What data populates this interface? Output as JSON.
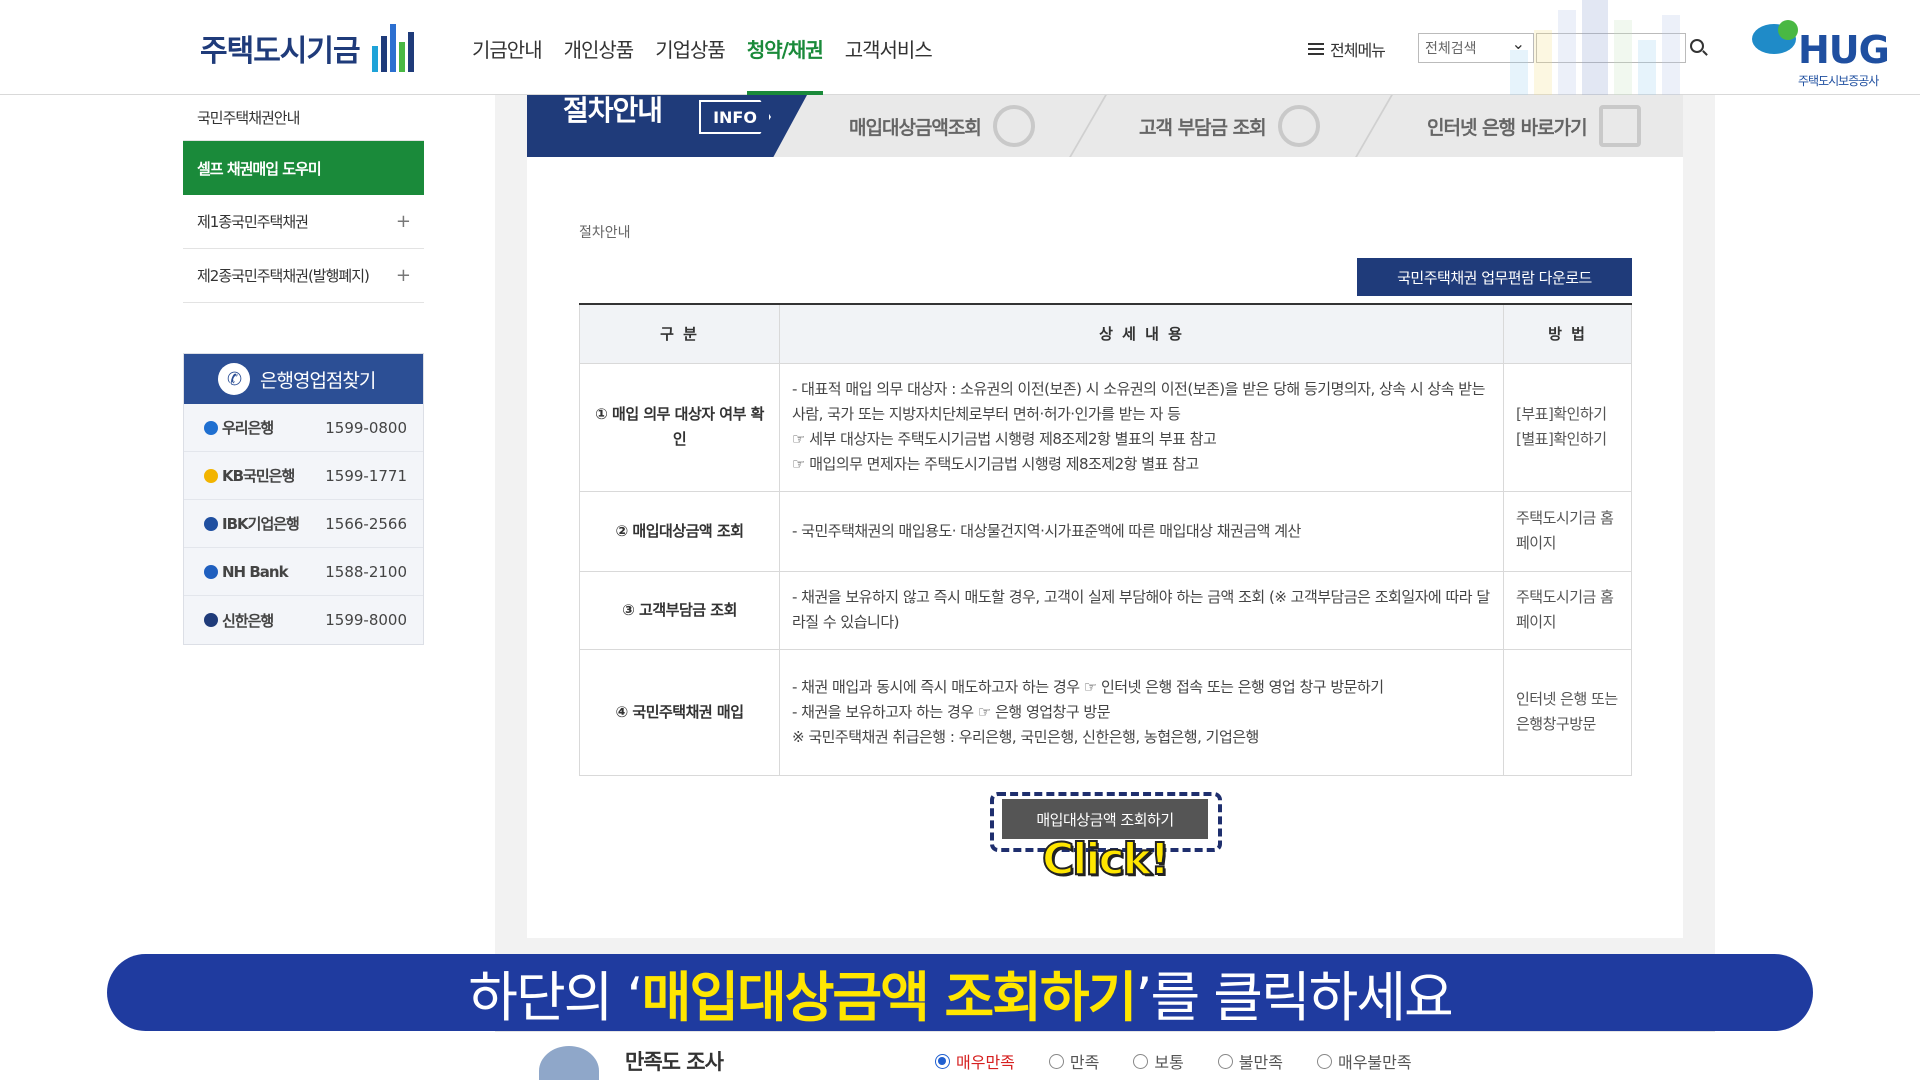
{
  "header": {
    "logo_text": "주택도시기금",
    "nav": [
      "기금안내",
      "개인상품",
      "기업상품",
      "청약/채권",
      "고객서비스"
    ],
    "nav_active_index": 3,
    "all_menu": "전체메뉴",
    "search_select": "전체검색",
    "search_placeholder": "",
    "brand": {
      "name": "HUG",
      "sub": "주택도시보증공사"
    }
  },
  "sidebar": {
    "items": [
      {
        "label": "국민주택채권안내",
        "plus": ""
      },
      {
        "label": "셀프 채권매입 도우미",
        "plus": ""
      },
      {
        "label": "제1종국민주택채권",
        "plus": "+"
      },
      {
        "label": "제2종국민주택채권(발행폐지)",
        "plus": "+"
      }
    ],
    "active_index": 1
  },
  "bank_finder": {
    "title": "은행영업점찾기",
    "banks": [
      {
        "name": "우리은행",
        "phone": "1599-0800",
        "color": "#1f6fd0"
      },
      {
        "name": "KB국민은행",
        "phone": "1599-1771",
        "color": "#f2b400"
      },
      {
        "name": "IBK기업은행",
        "phone": "1566-2566",
        "color": "#1f4fa0"
      },
      {
        "name": "NH Bank",
        "phone": "1588-2100",
        "color": "#1f5fbf"
      },
      {
        "name": "신한은행",
        "phone": "1599-8000",
        "color": "#1f3b7a"
      }
    ]
  },
  "tabs": {
    "info_title": "절차안내",
    "info_badge": "INFO",
    "items": [
      "매입대상금액조회",
      "고객 부담금 조회",
      "인터넷 은행 바로가기"
    ]
  },
  "breadcrumb": "절차안내",
  "download_button": "국민주택채권 업무편람 다운로드",
  "table": {
    "headers": [
      "구 분",
      "상 세 내 용",
      "방 법"
    ],
    "rows": [
      {
        "cat": "① 매입 의무 대상자 여부 확인",
        "detail": [
          "- 대표적 매입 의무 대상자 : 소유권의 이전(보존) 시 소유권의 이전(보존)을 받은 당해 등기명의자, 상속 시 상속 받는 사람, 국가 또는 지방자치단체로부터 면허·허가·인가를 받는 자 등",
          "☞ 세부 대상자는 주택도시기금법 시행령 제8조제2항 별표의 부표 참고",
          "☞ 매입의무 면제자는 주택도시기금법 시행령 제8조제2항 별표 참고"
        ],
        "method": [
          "[부표]확인하기",
          "[별표]확인하기"
        ]
      },
      {
        "cat": "② 매입대상금액 조회",
        "detail": [
          "- 국민주택채권의 매입용도· 대상물건지역·시가표준액에 따른 매입대상 채권금액 계산"
        ],
        "method": [
          "주택도시기금 홈페이지"
        ]
      },
      {
        "cat": "③ 고객부담금 조회",
        "detail": [
          "- 채권을 보유하지 않고 즉시 매도할 경우, 고객이 실제 부담해야 하는 금액 조회 (※ 고객부담금은 조회일자에 따라 달라질 수 있습니다)"
        ],
        "method": [
          "주택도시기금 홈페이지"
        ]
      },
      {
        "cat": "④ 국민주택채권 매입",
        "detail": [
          "- 채권 매입과 동시에 즉시 매도하고자 하는 경우 ☞ 인터넷 은행 접속 또는 은행 영업 창구 방문하기",
          "- 채권을 보유하고자 하는 경우 ☞ 은행 영업창구 방문",
          "※ 국민주택채권 취급은행 : 우리은행, 국민은행, 신한은행, 농협은행, 기업은행"
        ],
        "method": [
          "인터넷 은행 또는 은행창구방문"
        ]
      }
    ]
  },
  "action_button": "매입대상금액 조회하기",
  "click_label": "Click!",
  "caption": {
    "pre": "하단의 ‘",
    "highlight": "매입대상금액 조회하기",
    "post": "’를 클릭하세요"
  },
  "survey": {
    "title": "만족도 조사",
    "options": [
      "매우만족",
      "만족",
      "보통",
      "불만족",
      "매우불만족"
    ],
    "selected_index": 0
  }
}
